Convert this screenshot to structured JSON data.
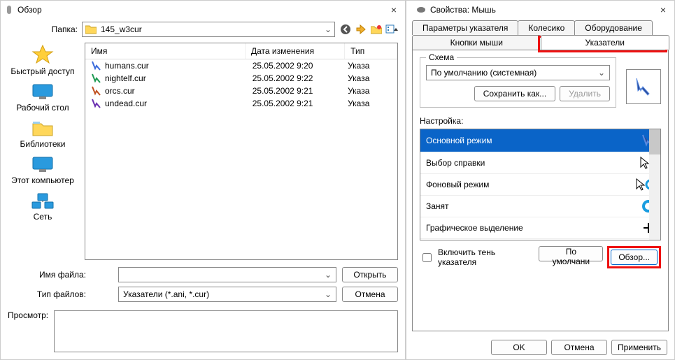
{
  "browse": {
    "title": "Обзор",
    "folder_label": "Папка:",
    "folder_value": "145_w3cur",
    "places": [
      {
        "label": "Быстрый доступ",
        "icon": "star"
      },
      {
        "label": "Рабочий стол",
        "icon": "desktop"
      },
      {
        "label": "Библиотеки",
        "icon": "libraries"
      },
      {
        "label": "Этот компьютер",
        "icon": "computer"
      },
      {
        "label": "Сеть",
        "icon": "network"
      }
    ],
    "columns": {
      "name": "Имя",
      "date": "Дата изменения",
      "type": "Тип"
    },
    "files": [
      {
        "name": "humans.cur",
        "date": "25.05.2002 9:20",
        "type": "Указа"
      },
      {
        "name": "nightelf.cur",
        "date": "25.05.2002 9:22",
        "type": "Указа"
      },
      {
        "name": "orcs.cur",
        "date": "25.05.2002 9:21",
        "type": "Указа"
      },
      {
        "name": "undead.cur",
        "date": "25.05.2002 9:21",
        "type": "Указа"
      }
    ],
    "filename_label": "Имя файла:",
    "filename_value": "",
    "filetype_label": "Тип файлов:",
    "filetype_value": "Указатели (*.ani, *.cur)",
    "open_btn": "Открыть",
    "cancel_btn": "Отмена",
    "preview_label": "Просмотр:"
  },
  "props": {
    "title": "Свойства: Мышь",
    "tabs_top": [
      "Параметры указателя",
      "Колесико",
      "Оборудование"
    ],
    "tabs_bottom": [
      "Кнопки мыши",
      "Указатели"
    ],
    "scheme_legend": "Схема",
    "scheme_value": "По умолчанию (системная)",
    "save_as_btn": "Сохранить как...",
    "delete_btn": "Удалить",
    "settings_label": "Настройка:",
    "pointers": [
      {
        "label": "Основной режим",
        "selected": true
      },
      {
        "label": "Выбор справки",
        "selected": false
      },
      {
        "label": "Фоновый режим",
        "selected": false
      },
      {
        "label": "Занят",
        "selected": false
      },
      {
        "label": "Графическое выделение",
        "selected": false
      }
    ],
    "shadow_label": "Включить тень указателя",
    "default_btn": "По умолчани",
    "browse_btn": "Обзор...",
    "ok_btn": "OK",
    "cancel_btn": "Отмена",
    "apply_btn": "Применить"
  }
}
